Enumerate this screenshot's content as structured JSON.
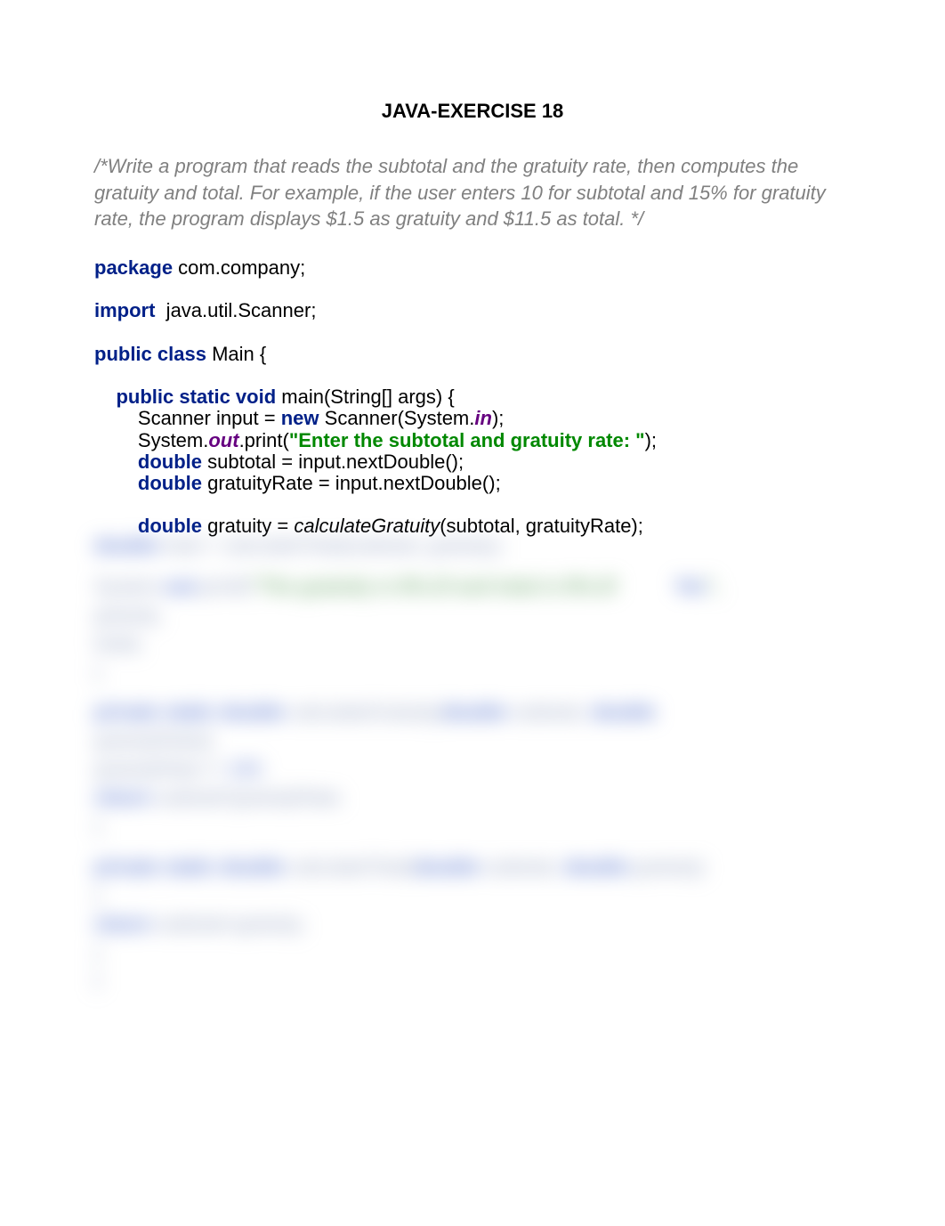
{
  "title": "JAVA-EXERCISE 18",
  "comment": "/*Write a program that reads the subtotal and the gratuity rate, then computes   the gratuity and total. For example, if the user enters 10 for subtotal and  15% for gratuity rate, the program displays $1.5 as gratuity and $11.5 as total.\n*/",
  "code": {
    "l1a": "package",
    "l1b": " com.company;",
    "l2a": "import",
    "l2b": "  java.util.Scanner;",
    "l3a": "public class",
    "l3b": " Main {",
    "l4a": "    public static void",
    "l4b": " main(String[] args) {",
    "l5a": "        Scanner input = ",
    "l5b": "new",
    "l5c": " Scanner(System.",
    "l5d": "in",
    "l5e": ");",
    "l6a": "        System.",
    "l6b": "out",
    "l6c": ".print(",
    "l6d": "\"Enter the subtotal and gratuity rate: \"",
    "l6e": ");",
    "l7a": "        double",
    "l7b": " subtotal = input.nextDouble();",
    "l8a": "        double",
    "l8b": " gratuityRate = input.nextDouble();",
    "l9a": "        double",
    "l9b": " gratuity = ",
    "l9c": "calculateGratuity",
    "l9d": "(subtotal, gratuityRate);"
  },
  "blurred": {
    "b1a": "        double",
    "b1b": "  total = ",
    "b1c": "calculateTotal",
    "b1d": "(subtotal, gratuity);",
    "b2a": "        System.",
    "b2b": "out",
    "b2c": ".printf(",
    "b2d": "\"The gratuity is $%.2f and total is $%.2f",
    "b2e": "%n",
    "b2f": "\",",
    "b3": "gratuity,",
    "b4": "                total);",
    "b5": "    }",
    "b6a": "    private static double",
    "b6b": "        calculateGratuity(",
    "b6c": "double",
    "b6d": " subtotal, ",
    "b6e": "double",
    "b7": "gratuityRate){",
    "b8a": "        gratuityRate /= ",
    "b8b": "100",
    "b8c": ";",
    "b9a": "        return",
    "b9b": "  subtotal*gratuityRate;",
    "b10": "    }",
    "b11a": "    private static double",
    "b11b": "        calculateTotal(",
    "b11c": "double",
    "b11d": " subtotal, ",
    "b11e": "double",
    "b11f": " gratuity)",
    "b12": "{",
    "b13a": "        return",
    "b13b": "  subtotal+gratuity;",
    "b14": "    }",
    "b15": "}"
  }
}
